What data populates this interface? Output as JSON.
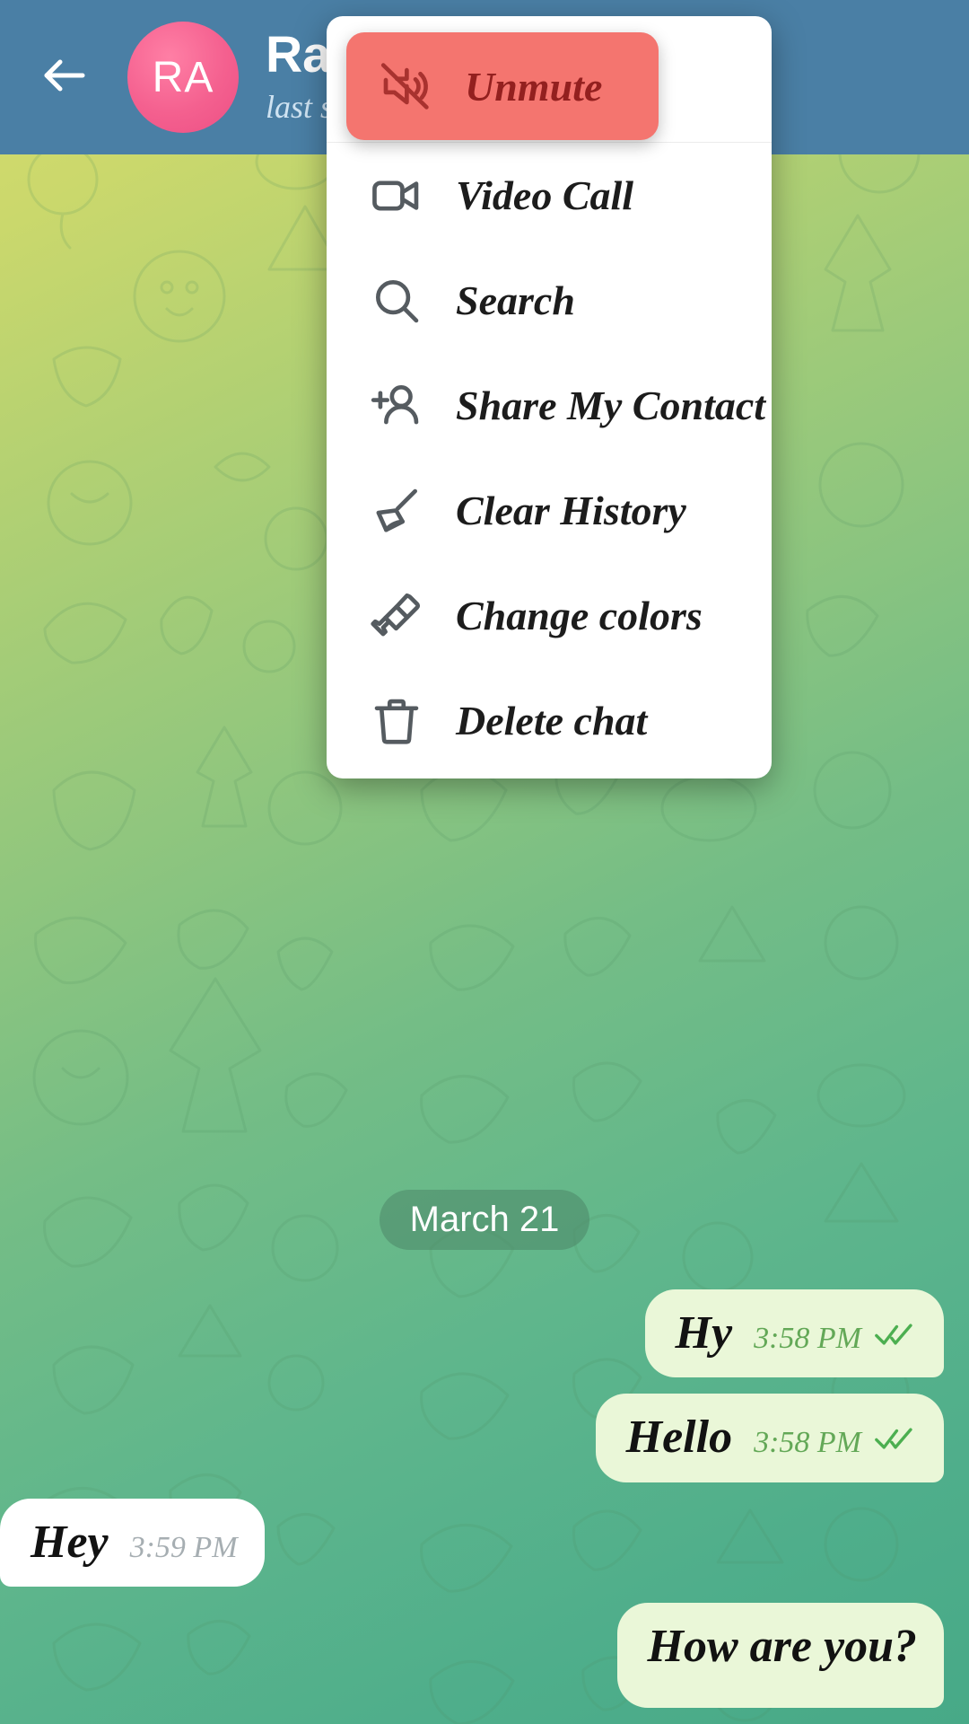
{
  "header": {
    "back_icon": "arrow-left-icon",
    "avatar_initials": "RA",
    "title": "Razi",
    "status": "last seen recently"
  },
  "menu": {
    "items": [
      {
        "label": "Unmute",
        "icon": "bell-muted-icon",
        "highlighted": true
      },
      {
        "label": "Video Call",
        "icon": "video-camera-icon",
        "highlighted": false
      },
      {
        "label": "Search",
        "icon": "search-icon",
        "highlighted": false
      },
      {
        "label": "Share My Contact",
        "icon": "person-add-icon",
        "highlighted": false
      },
      {
        "label": "Clear History",
        "icon": "broom-icon",
        "highlighted": false
      },
      {
        "label": "Change colors",
        "icon": "paint-brush-icon",
        "highlighted": false
      },
      {
        "label": "Delete chat",
        "icon": "trash-icon",
        "highlighted": false
      }
    ]
  },
  "chat": {
    "date_separator": "March 21",
    "messages": [
      {
        "text": "Hy",
        "time": "3:58 PM",
        "direction": "out",
        "status_icon": "double-check-icon"
      },
      {
        "text": "Hello",
        "time": "3:58 PM",
        "direction": "out",
        "status_icon": "double-check-icon"
      },
      {
        "text": "Hey",
        "time": "3:59 PM",
        "direction": "in",
        "status_icon": ""
      },
      {
        "text": "How are you?",
        "time": "",
        "direction": "out",
        "status_icon": ""
      }
    ]
  },
  "colors": {
    "header_bg": "#4a7fa5",
    "avatar_bg": "#f4608f",
    "highlight_bg": "#f4756f",
    "highlight_text": "#93201f",
    "outgoing_bubble": "#eaf7d8",
    "incoming_bubble": "#ffffff",
    "tick_green": "#4caf50",
    "date_badge_bg": "#4c8768"
  }
}
